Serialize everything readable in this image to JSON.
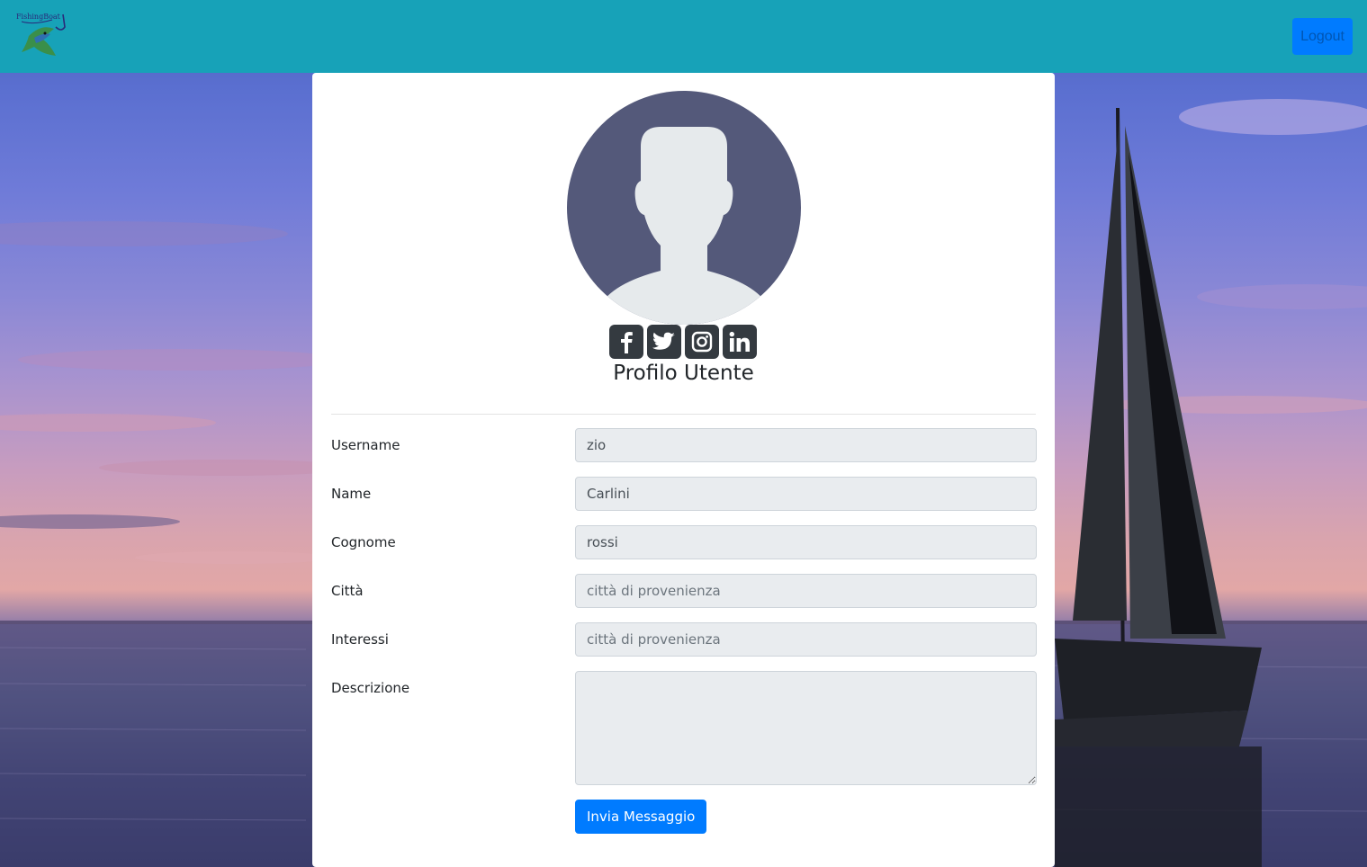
{
  "header": {
    "logo_text": "FishingBoat",
    "logout_label": "Logout",
    "bar_color": "#17a2b8"
  },
  "profile": {
    "title": "Profilo Utente",
    "avatar_icon": "user-silhouette-icon",
    "socials": [
      {
        "name": "facebook",
        "icon": "facebook-icon"
      },
      {
        "name": "twitter",
        "icon": "twitter-icon"
      },
      {
        "name": "instagram",
        "icon": "instagram-icon"
      },
      {
        "name": "linkedin",
        "icon": "linkedin-icon"
      }
    ]
  },
  "form": {
    "username": {
      "label": "Username",
      "value": "zio",
      "placeholder": ""
    },
    "name": {
      "label": "Name",
      "value": "Carlini",
      "placeholder": ""
    },
    "cognome": {
      "label": "Cognome",
      "value": "rossi",
      "placeholder": ""
    },
    "citta": {
      "label": "Città",
      "value": "",
      "placeholder": "città di provenienza"
    },
    "interessi": {
      "label": "Interessi",
      "value": "",
      "placeholder": "città di provenienza"
    },
    "descrizione": {
      "label": "Descrizione",
      "value": "",
      "placeholder": ""
    },
    "submit_label": "Invia Messaggio"
  },
  "colors": {
    "primary": "#007bff",
    "input_bg": "#e9ecef"
  }
}
